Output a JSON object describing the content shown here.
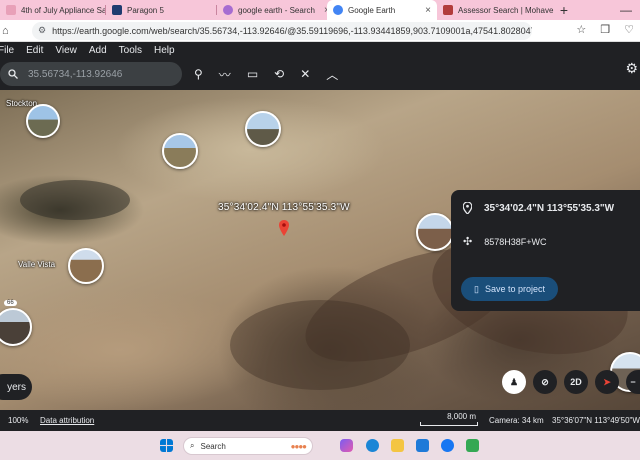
{
  "browser": {
    "tabs": [
      {
        "label": "4th of July Appliance Sale",
        "color": "#e8a0b8"
      },
      {
        "label": "Paragon 5",
        "color": "#1f3b70"
      },
      {
        "label": "google earth - Search",
        "color": "#a66cd1"
      },
      {
        "label": "Google Earth",
        "color": "#4285f4",
        "active": true
      },
      {
        "label": "Assessor Search | Mohave",
        "color": "#b23b3b"
      }
    ],
    "new_tab": "+",
    "url": "https://earth.google.com/web/search/35.56734,-113.92646/@35.59119696,-113.93441859,903.7109001a,47541.80280478d,35y,-97.3..."
  },
  "menu": {
    "items": [
      "File",
      "Edit",
      "View",
      "Add",
      "Tools",
      "Help"
    ]
  },
  "toolbar": {
    "search_value": "35.56734,-113.92646"
  },
  "map": {
    "coord_label": "35°34'02.4\"N 113°55'35.3\"W",
    "places": [
      {
        "label": "Stockton"
      },
      {
        "label": "Valle Vista"
      }
    ],
    "photo_badge": "66",
    "layers_label": "yers"
  },
  "card": {
    "coords": "35°34'02.4\"N 113°55'35.3\"W",
    "plus_code": "8578H38F+WC",
    "save_label": "Save to project"
  },
  "map_controls": {
    "mode_2d": "2D"
  },
  "status": {
    "zoom": "100%",
    "attribution": "Data attribution",
    "scale": "8,000 m",
    "camera": "Camera: 34 km",
    "latlng": "35°36'07\"N 113°49'50\"W"
  },
  "taskbar": {
    "search_label": "Search"
  },
  "colors": {
    "earth_dark": "#202124",
    "save_button": "#1a4e7a",
    "pin_red": "#ea4335",
    "tab_strip": "#f7c6d9"
  }
}
